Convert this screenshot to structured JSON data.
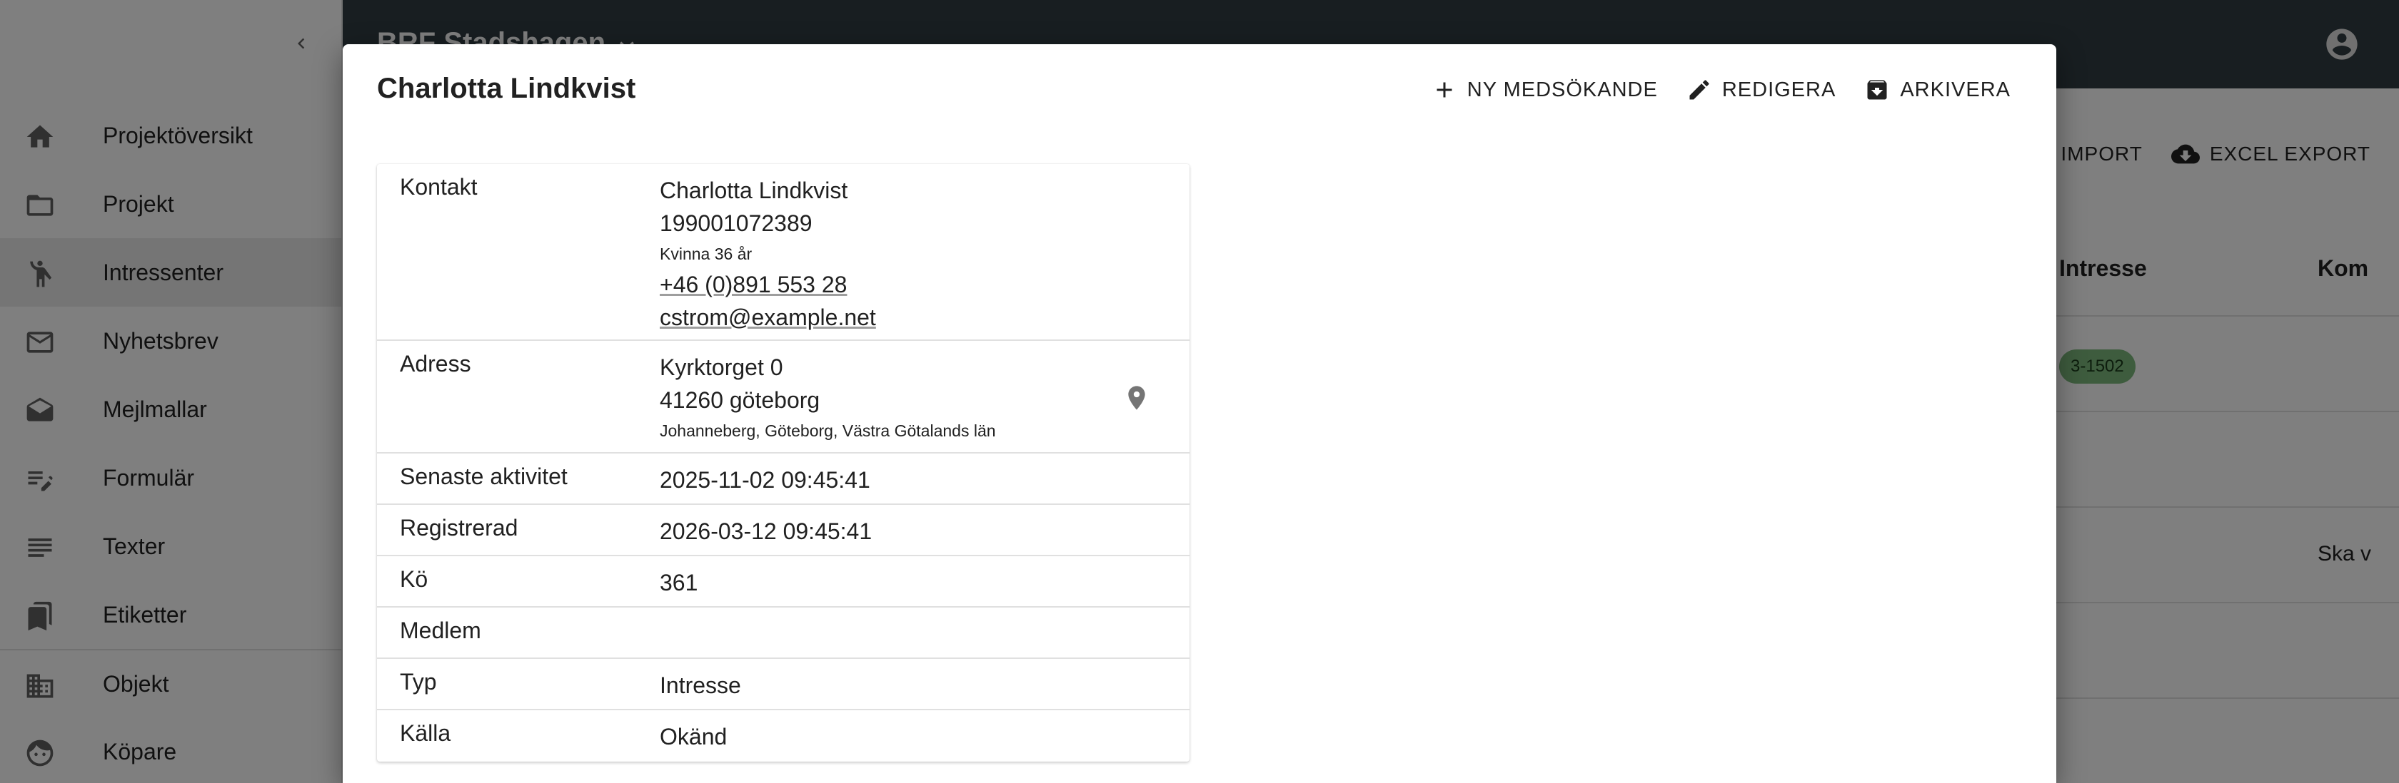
{
  "sidebar": {
    "items": [
      {
        "label": "Projektöversikt",
        "icon": "home-icon"
      },
      {
        "label": "Projekt",
        "icon": "folder-icon"
      },
      {
        "label": "Intressenter",
        "icon": "person-icon"
      },
      {
        "label": "Nyhetsbrev",
        "icon": "mail-icon"
      },
      {
        "label": "Mejlmallar",
        "icon": "drafts-icon"
      },
      {
        "label": "Formulär",
        "icon": "form-icon"
      },
      {
        "label": "Texter",
        "icon": "text-icon"
      },
      {
        "label": "Etiketter",
        "icon": "bookmark-icon"
      },
      {
        "label": "Objekt",
        "icon": "building-icon"
      },
      {
        "label": "Köpare",
        "icon": "face-icon"
      }
    ]
  },
  "appbar": {
    "project_name": "BRF Stadshagen"
  },
  "background": {
    "actions": [
      "IMPORT",
      "EXCEL EXPORT"
    ],
    "columns": [
      "Intresse",
      "Kom"
    ],
    "chip": "3-1502",
    "row_text": "Ska v"
  },
  "dialog": {
    "title": "Charlotta Lindkvist",
    "actions": {
      "new_co_applicant": "NY MEDSÖKANDE",
      "edit": "REDIGERA",
      "archive": "ARKIVERA"
    },
    "info": {
      "kontakt": {
        "label": "Kontakt",
        "name": "Charlotta Lindkvist",
        "personal_number": "199001072389",
        "gender_age": "Kvinna 36 år",
        "phone": "+46 (0)891 553 28",
        "email": "cstrom@example.net"
      },
      "adress": {
        "label": "Adress",
        "street": "Kyrktorget 0",
        "postal": "41260 göteborg",
        "region": "Johanneberg, Göteborg, Västra Götalands län"
      },
      "rows": [
        {
          "label": "Senaste aktivitet",
          "value": "2025-11-02 09:45:41"
        },
        {
          "label": "Registrerad",
          "value": "2026-03-12 09:45:41"
        },
        {
          "label": "Kö",
          "value": "361"
        },
        {
          "label": "Medlem",
          "value": ""
        },
        {
          "label": "Typ",
          "value": "Intresse"
        },
        {
          "label": "Källa",
          "value": "Okänd"
        }
      ]
    }
  }
}
